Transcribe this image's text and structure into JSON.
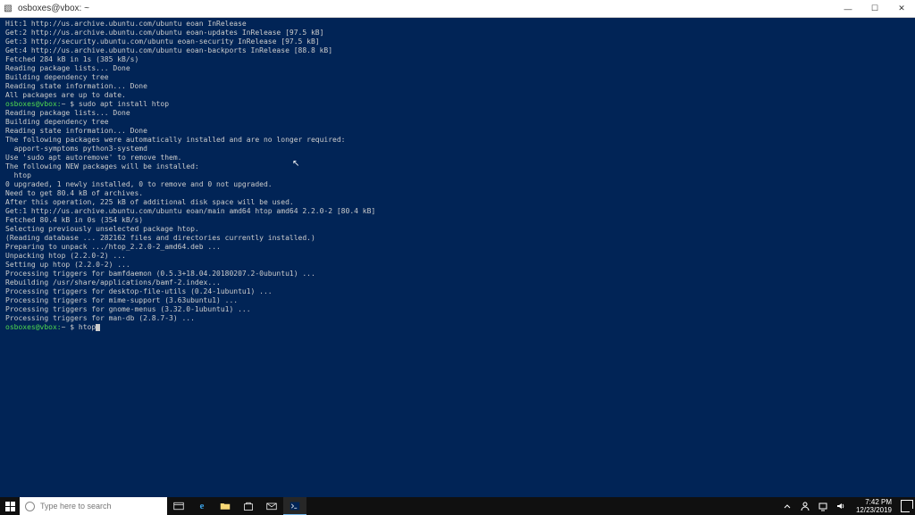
{
  "window": {
    "title": "osboxes@vbox: ~",
    "min_glyph": "—",
    "max_glyph": "☐",
    "close_glyph": "✕"
  },
  "prompt": {
    "user_host": "osboxes@vbox:",
    "path_sep": "~ $ "
  },
  "commands": {
    "install": "sudo apt install htop",
    "htop": "htop"
  },
  "output": [
    "Hit:1 http://us.archive.ubuntu.com/ubuntu eoan InRelease",
    "Get:2 http://us.archive.ubuntu.com/ubuntu eoan-updates InRelease [97.5 kB]",
    "Get:3 http://security.ubuntu.com/ubuntu eoan-security InRelease [97.5 kB]",
    "Get:4 http://us.archive.ubuntu.com/ubuntu eoan-backports InRelease [88.8 kB]",
    "Fetched 284 kB in 1s (385 kB/s)",
    "Reading package lists... Done",
    "Building dependency tree",
    "Reading state information... Done",
    "All packages are up to date."
  ],
  "output2": [
    "Reading package lists... Done",
    "Building dependency tree",
    "Reading state information... Done",
    "The following packages were automatically installed and are no longer required:",
    "  apport-symptoms python3-systemd",
    "Use 'sudo apt autoremove' to remove them.",
    "The following NEW packages will be installed:",
    "  htop",
    "0 upgraded, 1 newly installed, 0 to remove and 0 not upgraded.",
    "Need to get 80.4 kB of archives.",
    "After this operation, 225 kB of additional disk space will be used.",
    "Get:1 http://us.archive.ubuntu.com/ubuntu eoan/main amd64 htop amd64 2.2.0-2 [80.4 kB]",
    "Fetched 80.4 kB in 0s (354 kB/s)",
    "Selecting previously unselected package htop.",
    "(Reading database ... 282162 files and directories currently installed.)",
    "Preparing to unpack .../htop_2.2.0-2_amd64.deb ...",
    "Unpacking htop (2.2.0-2) ...",
    "Setting up htop (2.2.0-2) ...",
    "Processing triggers for bamfdaemon (0.5.3+18.04.20180207.2-0ubuntu1) ...",
    "Rebuilding /usr/share/applications/bamf-2.index...",
    "Processing triggers for desktop-file-utils (0.24-1ubuntu1) ...",
    "Processing triggers for mime-support (3.63ubuntu1) ...",
    "Processing triggers for gnome-menus (3.32.0-1ubuntu1) ...",
    "Processing triggers for man-db (2.8.7-3) ..."
  ],
  "taskbar": {
    "search_placeholder": "Type here to search",
    "time": "7:42 PM",
    "date": "12/23/2019"
  }
}
